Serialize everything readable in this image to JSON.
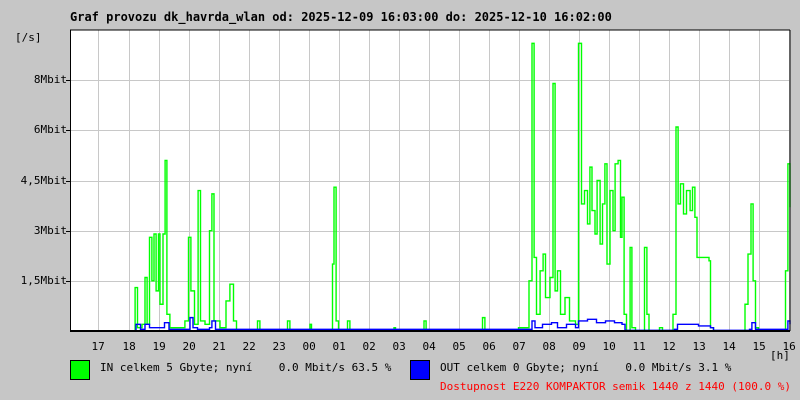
{
  "chart_data": {
    "type": "line",
    "title": "Graf provozu dk_havrda_wlan od: 2025-12-09 16:03:00 do: 2025-12-10 16:02:00",
    "ylabel": "[/s]",
    "xlabel": "[h]",
    "xlim": [
      16.05,
      40.05
    ],
    "ylim": [
      0,
      9
    ],
    "yticks": [
      {
        "value": 1.5,
        "label": "1,5Mbit"
      },
      {
        "value": 3,
        "label": "3Mbit"
      },
      {
        "value": 4.5,
        "label": "4,5Mbit"
      },
      {
        "value": 6,
        "label": "6Mbit"
      },
      {
        "value": 7.5,
        "label": "8Mbit"
      }
    ],
    "xticks": [
      {
        "value": 17,
        "label": "17"
      },
      {
        "value": 18,
        "label": "18"
      },
      {
        "value": 19,
        "label": "19"
      },
      {
        "value": 20,
        "label": "20"
      },
      {
        "value": 21,
        "label": "21"
      },
      {
        "value": 22,
        "label": "22"
      },
      {
        "value": 23,
        "label": "23"
      },
      {
        "value": 24,
        "label": "00"
      },
      {
        "value": 25,
        "label": "01"
      },
      {
        "value": 26,
        "label": "02"
      },
      {
        "value": 27,
        "label": "03"
      },
      {
        "value": 28,
        "label": "04"
      },
      {
        "value": 29,
        "label": "05"
      },
      {
        "value": 30,
        "label": "06"
      },
      {
        "value": 31,
        "label": "07"
      },
      {
        "value": 32,
        "label": "08"
      },
      {
        "value": 33,
        "label": "09"
      },
      {
        "value": 34,
        "label": "10"
      },
      {
        "value": 35,
        "label": "11"
      },
      {
        "value": 36,
        "label": "12"
      },
      {
        "value": 37,
        "label": "13"
      },
      {
        "value": 38,
        "label": "14"
      },
      {
        "value": 39,
        "label": "15"
      },
      {
        "value": 40,
        "label": "16"
      }
    ],
    "grid": true,
    "units": "Mbit/s",
    "series": [
      {
        "name": "IN",
        "color": "#00ff00",
        "points": [
          [
            16.05,
            0
          ],
          [
            18.1,
            0
          ],
          [
            18.22,
            1.3
          ],
          [
            18.3,
            0.1
          ],
          [
            18.45,
            0.2
          ],
          [
            18.55,
            1.6
          ],
          [
            18.62,
            0.2
          ],
          [
            18.7,
            2.8
          ],
          [
            18.78,
            1.5
          ],
          [
            18.85,
            2.9
          ],
          [
            18.92,
            1.2
          ],
          [
            19.0,
            2.9
          ],
          [
            19.05,
            0.8
          ],
          [
            19.15,
            2.9
          ],
          [
            19.22,
            5.1
          ],
          [
            19.28,
            0.5
          ],
          [
            19.38,
            0.1
          ],
          [
            19.7,
            0.1
          ],
          [
            19.88,
            0.3
          ],
          [
            20.0,
            2.8
          ],
          [
            20.08,
            1.2
          ],
          [
            20.2,
            0.2
          ],
          [
            20.32,
            4.2
          ],
          [
            20.4,
            0.3
          ],
          [
            20.55,
            0.2
          ],
          [
            20.7,
            3.0
          ],
          [
            20.78,
            4.1
          ],
          [
            20.85,
            0.3
          ],
          [
            21.05,
            0.1
          ],
          [
            21.25,
            0.9
          ],
          [
            21.38,
            1.4
          ],
          [
            21.5,
            0.3
          ],
          [
            21.6,
            0
          ],
          [
            22.3,
            0.3
          ],
          [
            22.38,
            0
          ],
          [
            23.3,
            0.3
          ],
          [
            23.38,
            0
          ],
          [
            24.05,
            0.2
          ],
          [
            24.1,
            0
          ],
          [
            24.8,
            2.0
          ],
          [
            24.85,
            4.3
          ],
          [
            24.92,
            0.3
          ],
          [
            25.0,
            0
          ],
          [
            25.3,
            0.3
          ],
          [
            25.38,
            0
          ],
          [
            26.85,
            0.1
          ],
          [
            26.9,
            0
          ],
          [
            27.85,
            0.3
          ],
          [
            27.92,
            0
          ],
          [
            29.8,
            0.4
          ],
          [
            29.88,
            0
          ],
          [
            31.0,
            0.1
          ],
          [
            31.35,
            1.5
          ],
          [
            31.45,
            8.6
          ],
          [
            31.52,
            2.2
          ],
          [
            31.6,
            0.5
          ],
          [
            31.72,
            1.8
          ],
          [
            31.82,
            2.3
          ],
          [
            31.9,
            1.0
          ],
          [
            32.05,
            1.6
          ],
          [
            32.15,
            7.4
          ],
          [
            32.22,
            1.2
          ],
          [
            32.3,
            1.8
          ],
          [
            32.4,
            0.5
          ],
          [
            32.55,
            1.0
          ],
          [
            32.7,
            0.3
          ],
          [
            32.9,
            0.2
          ],
          [
            33.0,
            8.6
          ],
          [
            33.1,
            3.8
          ],
          [
            33.2,
            4.2
          ],
          [
            33.3,
            3.2
          ],
          [
            33.38,
            4.9
          ],
          [
            33.45,
            3.6
          ],
          [
            33.55,
            2.9
          ],
          [
            33.62,
            4.5
          ],
          [
            33.72,
            2.6
          ],
          [
            33.8,
            3.8
          ],
          [
            33.88,
            5.0
          ],
          [
            33.95,
            2.0
          ],
          [
            34.05,
            4.2
          ],
          [
            34.15,
            3.0
          ],
          [
            34.22,
            5.0
          ],
          [
            34.32,
            5.1
          ],
          [
            34.4,
            2.8
          ],
          [
            34.45,
            4.0
          ],
          [
            34.52,
            0.5
          ],
          [
            34.6,
            0
          ],
          [
            34.72,
            2.5
          ],
          [
            34.78,
            0.1
          ],
          [
            34.9,
            0
          ],
          [
            35.2,
            2.5
          ],
          [
            35.28,
            0.5
          ],
          [
            35.35,
            0
          ],
          [
            35.7,
            0.1
          ],
          [
            35.8,
            0
          ],
          [
            36.15,
            0.5
          ],
          [
            36.25,
            6.1
          ],
          [
            36.32,
            3.8
          ],
          [
            36.4,
            4.4
          ],
          [
            36.5,
            3.5
          ],
          [
            36.6,
            4.2
          ],
          [
            36.72,
            3.6
          ],
          [
            36.8,
            4.3
          ],
          [
            36.88,
            3.4
          ],
          [
            36.95,
            2.2
          ],
          [
            37.1,
            2.2
          ],
          [
            37.22,
            2.2
          ],
          [
            37.35,
            2.1
          ],
          [
            37.4,
            0.1
          ],
          [
            37.5,
            0
          ],
          [
            38.4,
            0
          ],
          [
            38.55,
            0.8
          ],
          [
            38.65,
            2.3
          ],
          [
            38.75,
            3.8
          ],
          [
            38.82,
            1.5
          ],
          [
            38.9,
            0.1
          ],
          [
            39.0,
            0
          ],
          [
            39.8,
            0
          ],
          [
            39.9,
            1.8
          ],
          [
            39.98,
            5.0
          ],
          [
            40.05,
            3.7
          ]
        ]
      },
      {
        "name": "OUT",
        "color": "#0000ff",
        "points": [
          [
            16.05,
            0
          ],
          [
            18.15,
            0
          ],
          [
            18.25,
            0.2
          ],
          [
            18.4,
            0.05
          ],
          [
            18.55,
            0.2
          ],
          [
            18.7,
            0.1
          ],
          [
            19.0,
            0.1
          ],
          [
            19.2,
            0.25
          ],
          [
            19.35,
            0.05
          ],
          [
            20.0,
            0.05
          ],
          [
            20.05,
            0.4
          ],
          [
            20.15,
            0.1
          ],
          [
            20.3,
            0.05
          ],
          [
            20.7,
            0.1
          ],
          [
            20.78,
            0.3
          ],
          [
            20.9,
            0.05
          ],
          [
            24.85,
            0.05
          ],
          [
            31.3,
            0.05
          ],
          [
            31.45,
            0.3
          ],
          [
            31.55,
            0.1
          ],
          [
            31.8,
            0.2
          ],
          [
            32.1,
            0.25
          ],
          [
            32.3,
            0.1
          ],
          [
            32.6,
            0.2
          ],
          [
            32.9,
            0.1
          ],
          [
            33.0,
            0.3
          ],
          [
            33.3,
            0.35
          ],
          [
            33.6,
            0.25
          ],
          [
            33.9,
            0.3
          ],
          [
            34.2,
            0.25
          ],
          [
            34.45,
            0.2
          ],
          [
            34.55,
            0.02
          ],
          [
            36.2,
            0.05
          ],
          [
            36.3,
            0.2
          ],
          [
            36.7,
            0.2
          ],
          [
            37.0,
            0.15
          ],
          [
            37.4,
            0.1
          ],
          [
            37.5,
            0.02
          ],
          [
            38.7,
            0.05
          ],
          [
            38.78,
            0.25
          ],
          [
            38.9,
            0.05
          ],
          [
            39.9,
            0.05
          ],
          [
            39.98,
            0.3
          ],
          [
            40.05,
            0.2
          ]
        ]
      }
    ]
  },
  "legend": {
    "in_text": "IN celkem 5 Gbyte; nyní    0.0 Mbit/s 63.5 %",
    "out_text": "OUT celkem 0 Gbyte; nyní    0.0 Mbit/s 3.1 %",
    "availability": "Dostupnost E220 KOMPAKTOR semik 1440 z 1440 (100.0 %)",
    "in_color": "#00ff00",
    "out_color": "#0000ff",
    "availability_color": "#ff0000"
  }
}
